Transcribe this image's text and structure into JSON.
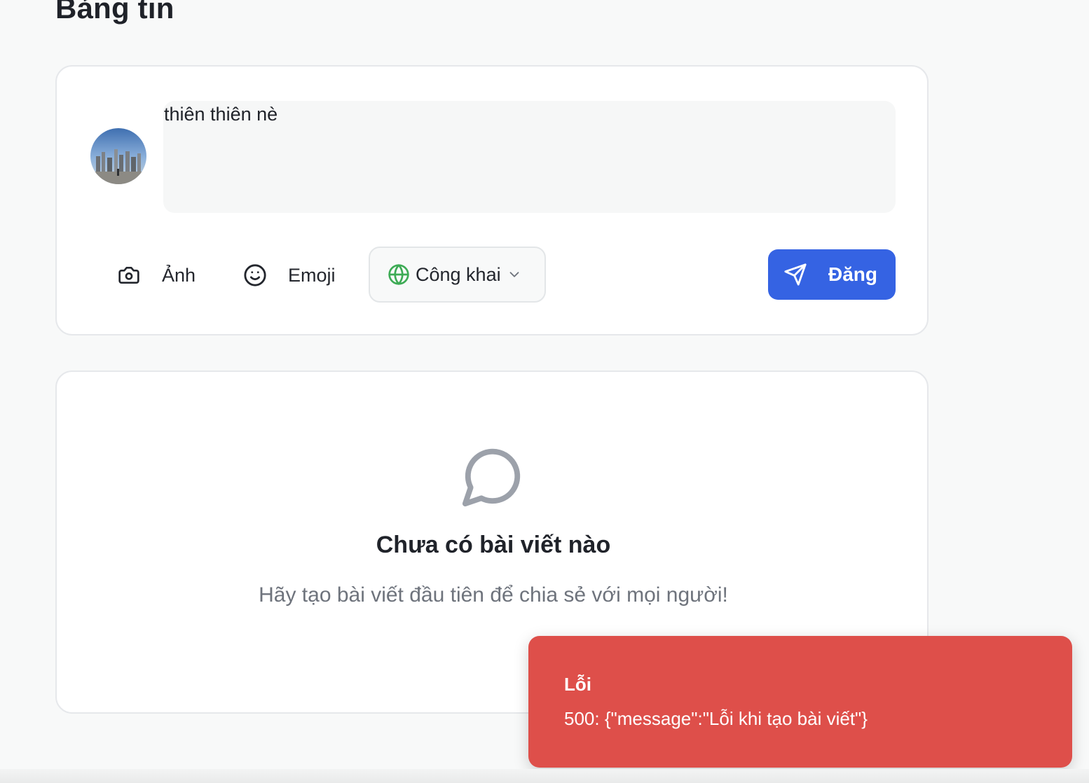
{
  "page": {
    "title": "Bảng tin"
  },
  "composer": {
    "post_text": "thiên thiên nè",
    "photo_label": "Ảnh",
    "emoji_label": "Emoji",
    "privacy": {
      "selected": "Công khai",
      "icon": "globe-icon"
    },
    "submit_label": "Đăng",
    "colors": {
      "submit": "#3563e3",
      "globe": "#3dab55"
    }
  },
  "feed": {
    "empty_icon": "message-circle-icon",
    "empty_title": "Chưa có bài viết nào",
    "empty_subtitle": "Hãy tạo bài viết đầu tiên để chia sẻ với mọi người!"
  },
  "toast": {
    "title": "Lỗi",
    "message": "500: {\"message\":\"Lỗi khi tạo bài viết\"}",
    "color": "#de4f4a"
  }
}
